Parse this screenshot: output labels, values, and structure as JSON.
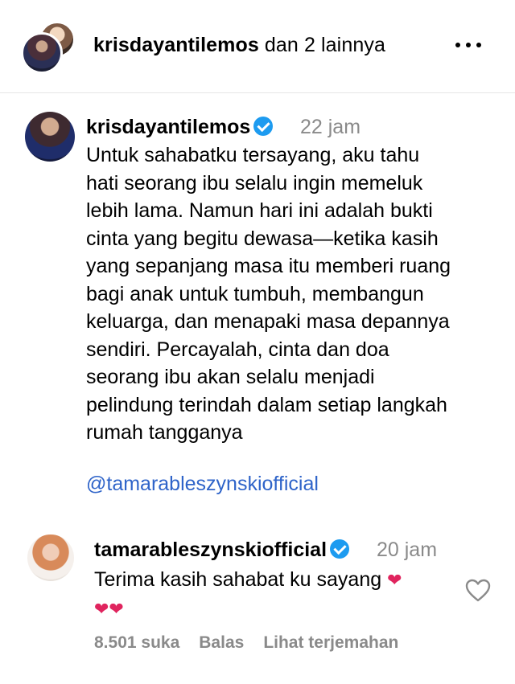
{
  "header": {
    "username": "krisdayantilemos",
    "others_text": "dan 2 lainnya"
  },
  "post": {
    "username": "krisdayantilemos",
    "time": "22 jam",
    "lines": [
      "Untuk sahabatku tersayang, aku tahu",
      "hati seorang ibu selalu ingin memeluk",
      "lebih lama. Namun hari ini adalah bukti",
      "cinta yang begitu dewasa—ketika kasih",
      "yang sepanjang masa itu memberi ruang",
      "bagi anak untuk tumbuh, membangun",
      "keluarga, dan menapaki masa depannya",
      "sendiri. Percayalah, cinta dan doa",
      "seorang ibu akan selalu menjadi",
      "pelindung terindah dalam setiap langkah",
      "rumah tangganya"
    ],
    "mention": "@tamarableszynskiofficial"
  },
  "reply": {
    "username": "tamarableszynskiofficial",
    "time": "20 jam",
    "text": "Terima kasih sahabat ku sayang",
    "heart1": "❤",
    "hearts2": "❤❤",
    "likes": "8.501 suka",
    "reply_label": "Balas",
    "translate_label": "Lihat terjemahan"
  },
  "icons": {
    "more": "more-horizontal-icon",
    "verified": "verified-badge-icon",
    "like": "heart-outline-icon"
  },
  "colors": {
    "verified": "#1d9bf0",
    "mention": "#2f64c9",
    "muted": "#8a8a8a"
  }
}
